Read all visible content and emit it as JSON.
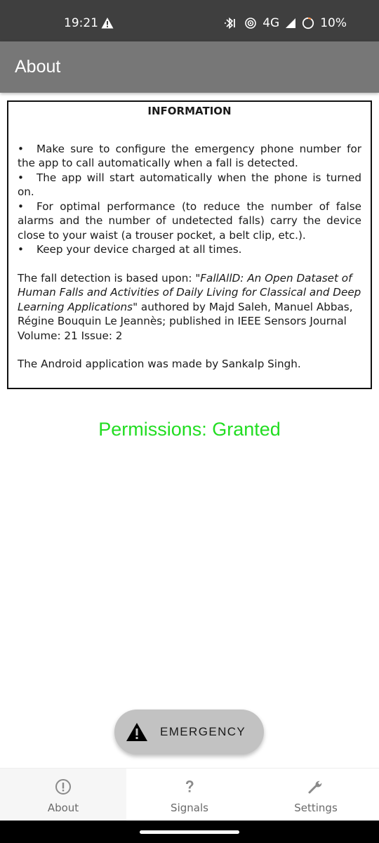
{
  "status_bar": {
    "time": "19:21",
    "network": "4G",
    "battery": "10%",
    "icons": [
      "alert-icon",
      "bluetooth-icon",
      "hotspot-icon",
      "signal-icon",
      "battery-icon"
    ]
  },
  "app_bar": {
    "title": "About"
  },
  "info": {
    "title": "INFORMATION",
    "bullets": [
      "Make sure to configure the emergency phone number for the app to call automatically when a fall is detected.",
      "The app will start automatically when the phone is turned on.",
      "For optimal performance (to reduce the number of false alarms and the number of undetected falls) carry the device close to your waist (a trouser pocket, a belt clip, etc.).",
      "Keep your device charged at all times."
    ],
    "paper_prefix": "The fall detection is based upon: ",
    "paper_title": "\"FallAllD: An Open Dataset of Human Falls and Activities of Daily Living for Classical and Deep Learning Applications\"",
    "paper_suffix": " authored by Majd Saleh, Manuel Abbas, Régine Bouquin Le Jeannès; published in IEEE Sensors Journal Volume: 21 Issue: 2",
    "credit": "The Android application was made by Sankalp Singh."
  },
  "permissions": {
    "text": "Permissions: Granted",
    "color": "#22dd22"
  },
  "emergency": {
    "label": "EMERGENCY",
    "icon": "warning-icon"
  },
  "bottom_nav": {
    "items": [
      {
        "label": "About",
        "icon": "info-icon",
        "active": true
      },
      {
        "label": "Signals",
        "icon": "question-icon",
        "active": false
      },
      {
        "label": "Settings",
        "icon": "wrench-icon",
        "active": false
      }
    ]
  },
  "colors": {
    "status_bar": "#3f3f3f",
    "app_bar": "#777777",
    "emergency_bg": "#c2c2c2"
  }
}
